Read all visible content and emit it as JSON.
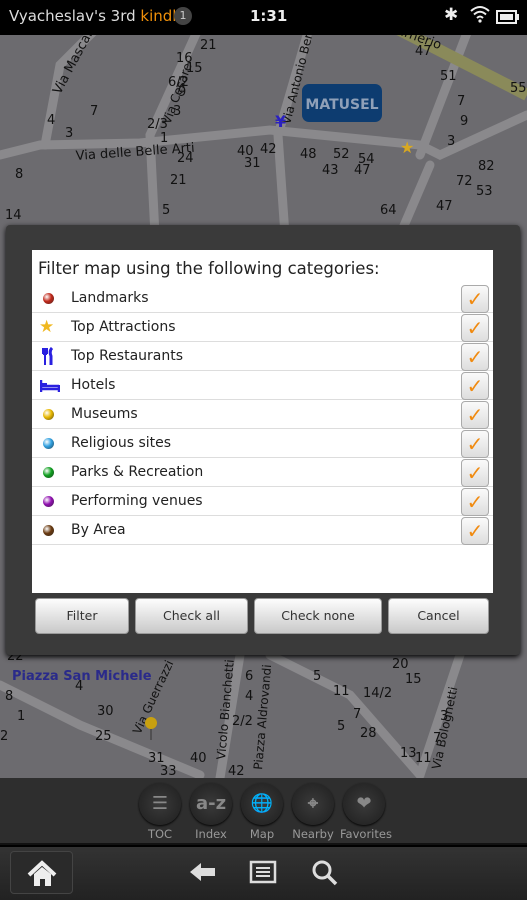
{
  "status_bar": {
    "device_name": "Vyacheslav's 3rd",
    "brand": "kindle",
    "notification_count": "1",
    "time": "1:31",
    "icons": [
      "gear-icon",
      "wifi-icon",
      "battery-icon"
    ]
  },
  "map": {
    "place_badge": "MATUSEL",
    "streets": [
      "Via Mascarella",
      "Via delle Belle Arti",
      "Via Cesare",
      "Via Antonio Bertoloni",
      "Irnerio",
      "Piazza San Michele",
      "Via Guerrazzi",
      "Vicolo Bianchetti",
      "Piazza Aldrovandi",
      "Via Bolognetti"
    ],
    "numbers": [
      "47",
      "51",
      "9",
      "55",
      "7",
      "3",
      "82",
      "72",
      "53",
      "47",
      "16",
      "15",
      "6/2",
      "9",
      "3",
      "2/3",
      "1",
      "21",
      "4",
      "3",
      "8",
      "7",
      "40",
      "42",
      "48",
      "52",
      "54",
      "43",
      "47",
      "31",
      "24",
      "21",
      "14",
      "5",
      "64",
      "22",
      "4",
      "8",
      "1",
      "2",
      "30",
      "25",
      "31",
      "33",
      "40",
      "42",
      "6",
      "4",
      "2/2",
      "5",
      "11",
      "14/2",
      "7",
      "5",
      "28",
      "13",
      "11",
      "20",
      "15",
      "3",
      "7"
    ]
  },
  "dialog": {
    "title": "Filter map using the following categories:",
    "categories": [
      {
        "label": "Landmarks",
        "icon": "red-dot-icon",
        "color": "#c0281a",
        "checked": true
      },
      {
        "label": "Top Attractions",
        "icon": "star-icon",
        "color": "#f0b820",
        "checked": true
      },
      {
        "label": "Top Restaurants",
        "icon": "fork-knife-icon",
        "color": "#2a20e0",
        "checked": true
      },
      {
        "label": "Hotels",
        "icon": "bed-icon",
        "color": "#2a20e0",
        "checked": true
      },
      {
        "label": "Museums",
        "icon": "yellow-dot-icon",
        "color": "#e8b800",
        "checked": true
      },
      {
        "label": "Religious sites",
        "icon": "blue-dot-icon",
        "color": "#30a0e0",
        "checked": true
      },
      {
        "label": "Parks & Recreation",
        "icon": "green-dot-icon",
        "color": "#10a020",
        "checked": true
      },
      {
        "label": "Performing venues",
        "icon": "purple-dot-icon",
        "color": "#9010b0",
        "checked": true
      },
      {
        "label": "By Area",
        "icon": "brown-dot-icon",
        "color": "#6a3a10",
        "checked": true
      }
    ],
    "buttons": {
      "filter": "Filter",
      "check_all": "Check all",
      "check_none": "Check none",
      "cancel": "Cancel"
    },
    "check_color": "#f08a10"
  },
  "toolbar": [
    {
      "label": "TOC",
      "icon": "list-icon",
      "glyph": "☰"
    },
    {
      "label": "Index",
      "icon": "a-z-icon",
      "glyph": "a-z"
    },
    {
      "label": "Map",
      "icon": "globe-icon",
      "glyph": "🌐"
    },
    {
      "label": "Nearby",
      "icon": "crosshair-icon",
      "glyph": "⌖"
    },
    {
      "label": "Favorites",
      "icon": "heart-icon",
      "glyph": "❤"
    }
  ],
  "nav": {
    "icons": [
      "home-icon",
      "back-icon",
      "menu-icon",
      "search-icon"
    ]
  }
}
